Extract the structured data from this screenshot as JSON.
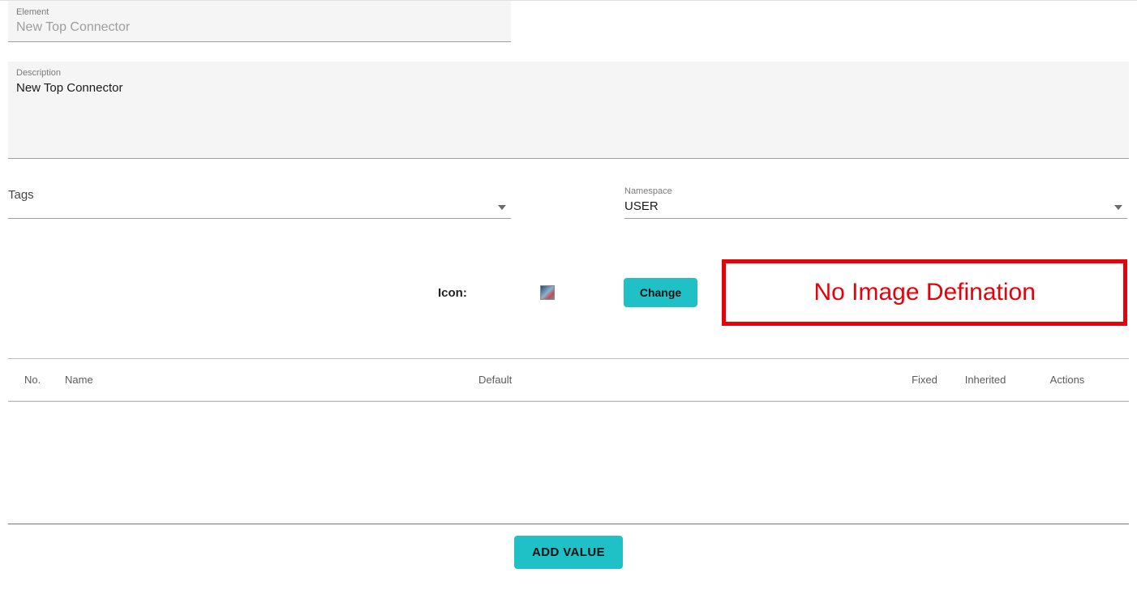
{
  "element": {
    "label": "Element",
    "value": "New Top Connector"
  },
  "description": {
    "label": "Description",
    "value": "New Top Connector"
  },
  "tags": {
    "label": "Tags",
    "value": ""
  },
  "namespace": {
    "label": "Namespace",
    "value": "USER"
  },
  "iconRow": {
    "label": "Icon:",
    "changeLabel": "Change"
  },
  "annotation": {
    "text": "No Image Defination"
  },
  "table": {
    "headers": {
      "no": "No.",
      "name": "Name",
      "default": "Default",
      "fixed": "Fixed",
      "inherited": "Inherited",
      "actions": "Actions"
    }
  },
  "footer": {
    "addValueLabel": "ADD VALUE"
  }
}
